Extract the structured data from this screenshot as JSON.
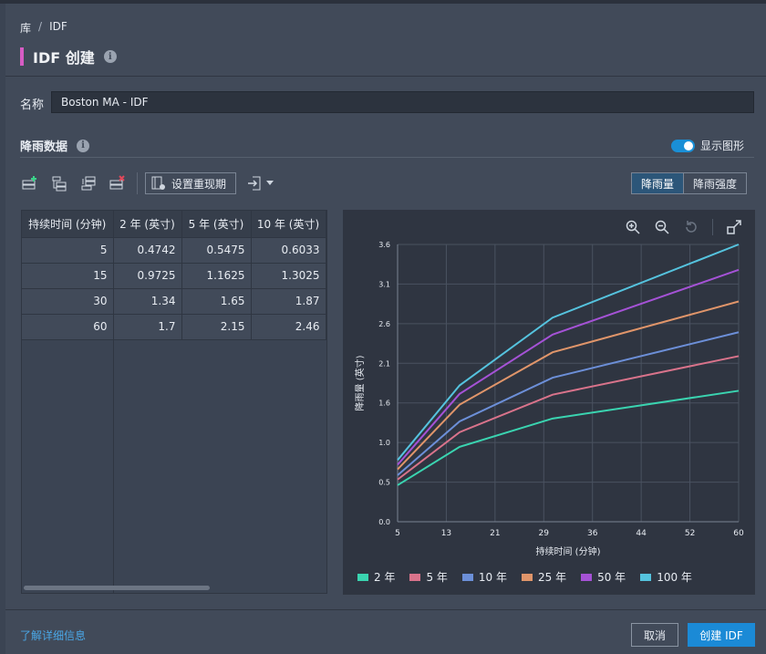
{
  "breadcrumb": {
    "root": "库",
    "separator": "/",
    "current": "IDF"
  },
  "header": {
    "title": "IDF 创建",
    "accent_color": "#d65cc4"
  },
  "name_field": {
    "label": "名称",
    "value": "Boston MA - IDF"
  },
  "rainfall_section": {
    "title": "降雨数据",
    "show_graph_label": "显示图形",
    "show_graph_on": true
  },
  "toolbar": {
    "icons": [
      "add-row-icon",
      "insert-row-icon",
      "move-rows-icon",
      "delete-row-icon"
    ],
    "reset_label": "设置重现期",
    "export_icon": "export-icon"
  },
  "view_toggle": {
    "depth_label": "降雨量",
    "intensity_label": "降雨强度",
    "active": "depth"
  },
  "table": {
    "headers": [
      "持续时间 (分钟)",
      "2 年 (英寸)",
      "5 年 (英寸)",
      "10 年 (英寸)"
    ],
    "rows": [
      [
        "5",
        "0.4742",
        "0.5475",
        "0.6033"
      ],
      [
        "15",
        "0.9725",
        "1.1625",
        "1.3025"
      ],
      [
        "30",
        "1.34",
        "1.65",
        "1.87"
      ],
      [
        "60",
        "1.7",
        "2.15",
        "2.46"
      ]
    ]
  },
  "chart_data": {
    "type": "line",
    "title": "",
    "xlabel": "持续时间 (分钟)",
    "ylabel": "降雨量 (英寸)",
    "x": [
      5,
      15,
      30,
      60
    ],
    "xlim": [
      5,
      60
    ],
    "ylim": [
      0,
      3.6
    ],
    "xticks": [
      "5",
      "13",
      "21",
      "29",
      "36",
      "44",
      "52",
      "60"
    ],
    "yticks": [
      "0.0",
      "0.5",
      "1.0",
      "1.6",
      "2.1",
      "2.6",
      "3.1",
      "3.6"
    ],
    "grid": true,
    "legend_position": "bottom",
    "series": [
      {
        "name": "2 年",
        "color": "#3ad4b0",
        "values": [
          0.4742,
          0.9725,
          1.34,
          1.7
        ]
      },
      {
        "name": "5 年",
        "color": "#d9738b",
        "values": [
          0.5475,
          1.1625,
          1.65,
          2.15
        ]
      },
      {
        "name": "10 年",
        "color": "#6c8fd8",
        "values": [
          0.6033,
          1.3025,
          1.87,
          2.46
        ]
      },
      {
        "name": "25 年",
        "color": "#e0956a",
        "values": [
          0.68,
          1.52,
          2.2,
          2.86
        ]
      },
      {
        "name": "50 年",
        "color": "#a552d6",
        "values": [
          0.74,
          1.66,
          2.43,
          3.27
        ]
      },
      {
        "name": "100 年",
        "color": "#55c3de",
        "values": [
          0.8,
          1.77,
          2.65,
          3.6
        ]
      }
    ]
  },
  "footer": {
    "learn_more": "了解详细信息",
    "cancel": "取消",
    "create": "创建 IDF"
  }
}
